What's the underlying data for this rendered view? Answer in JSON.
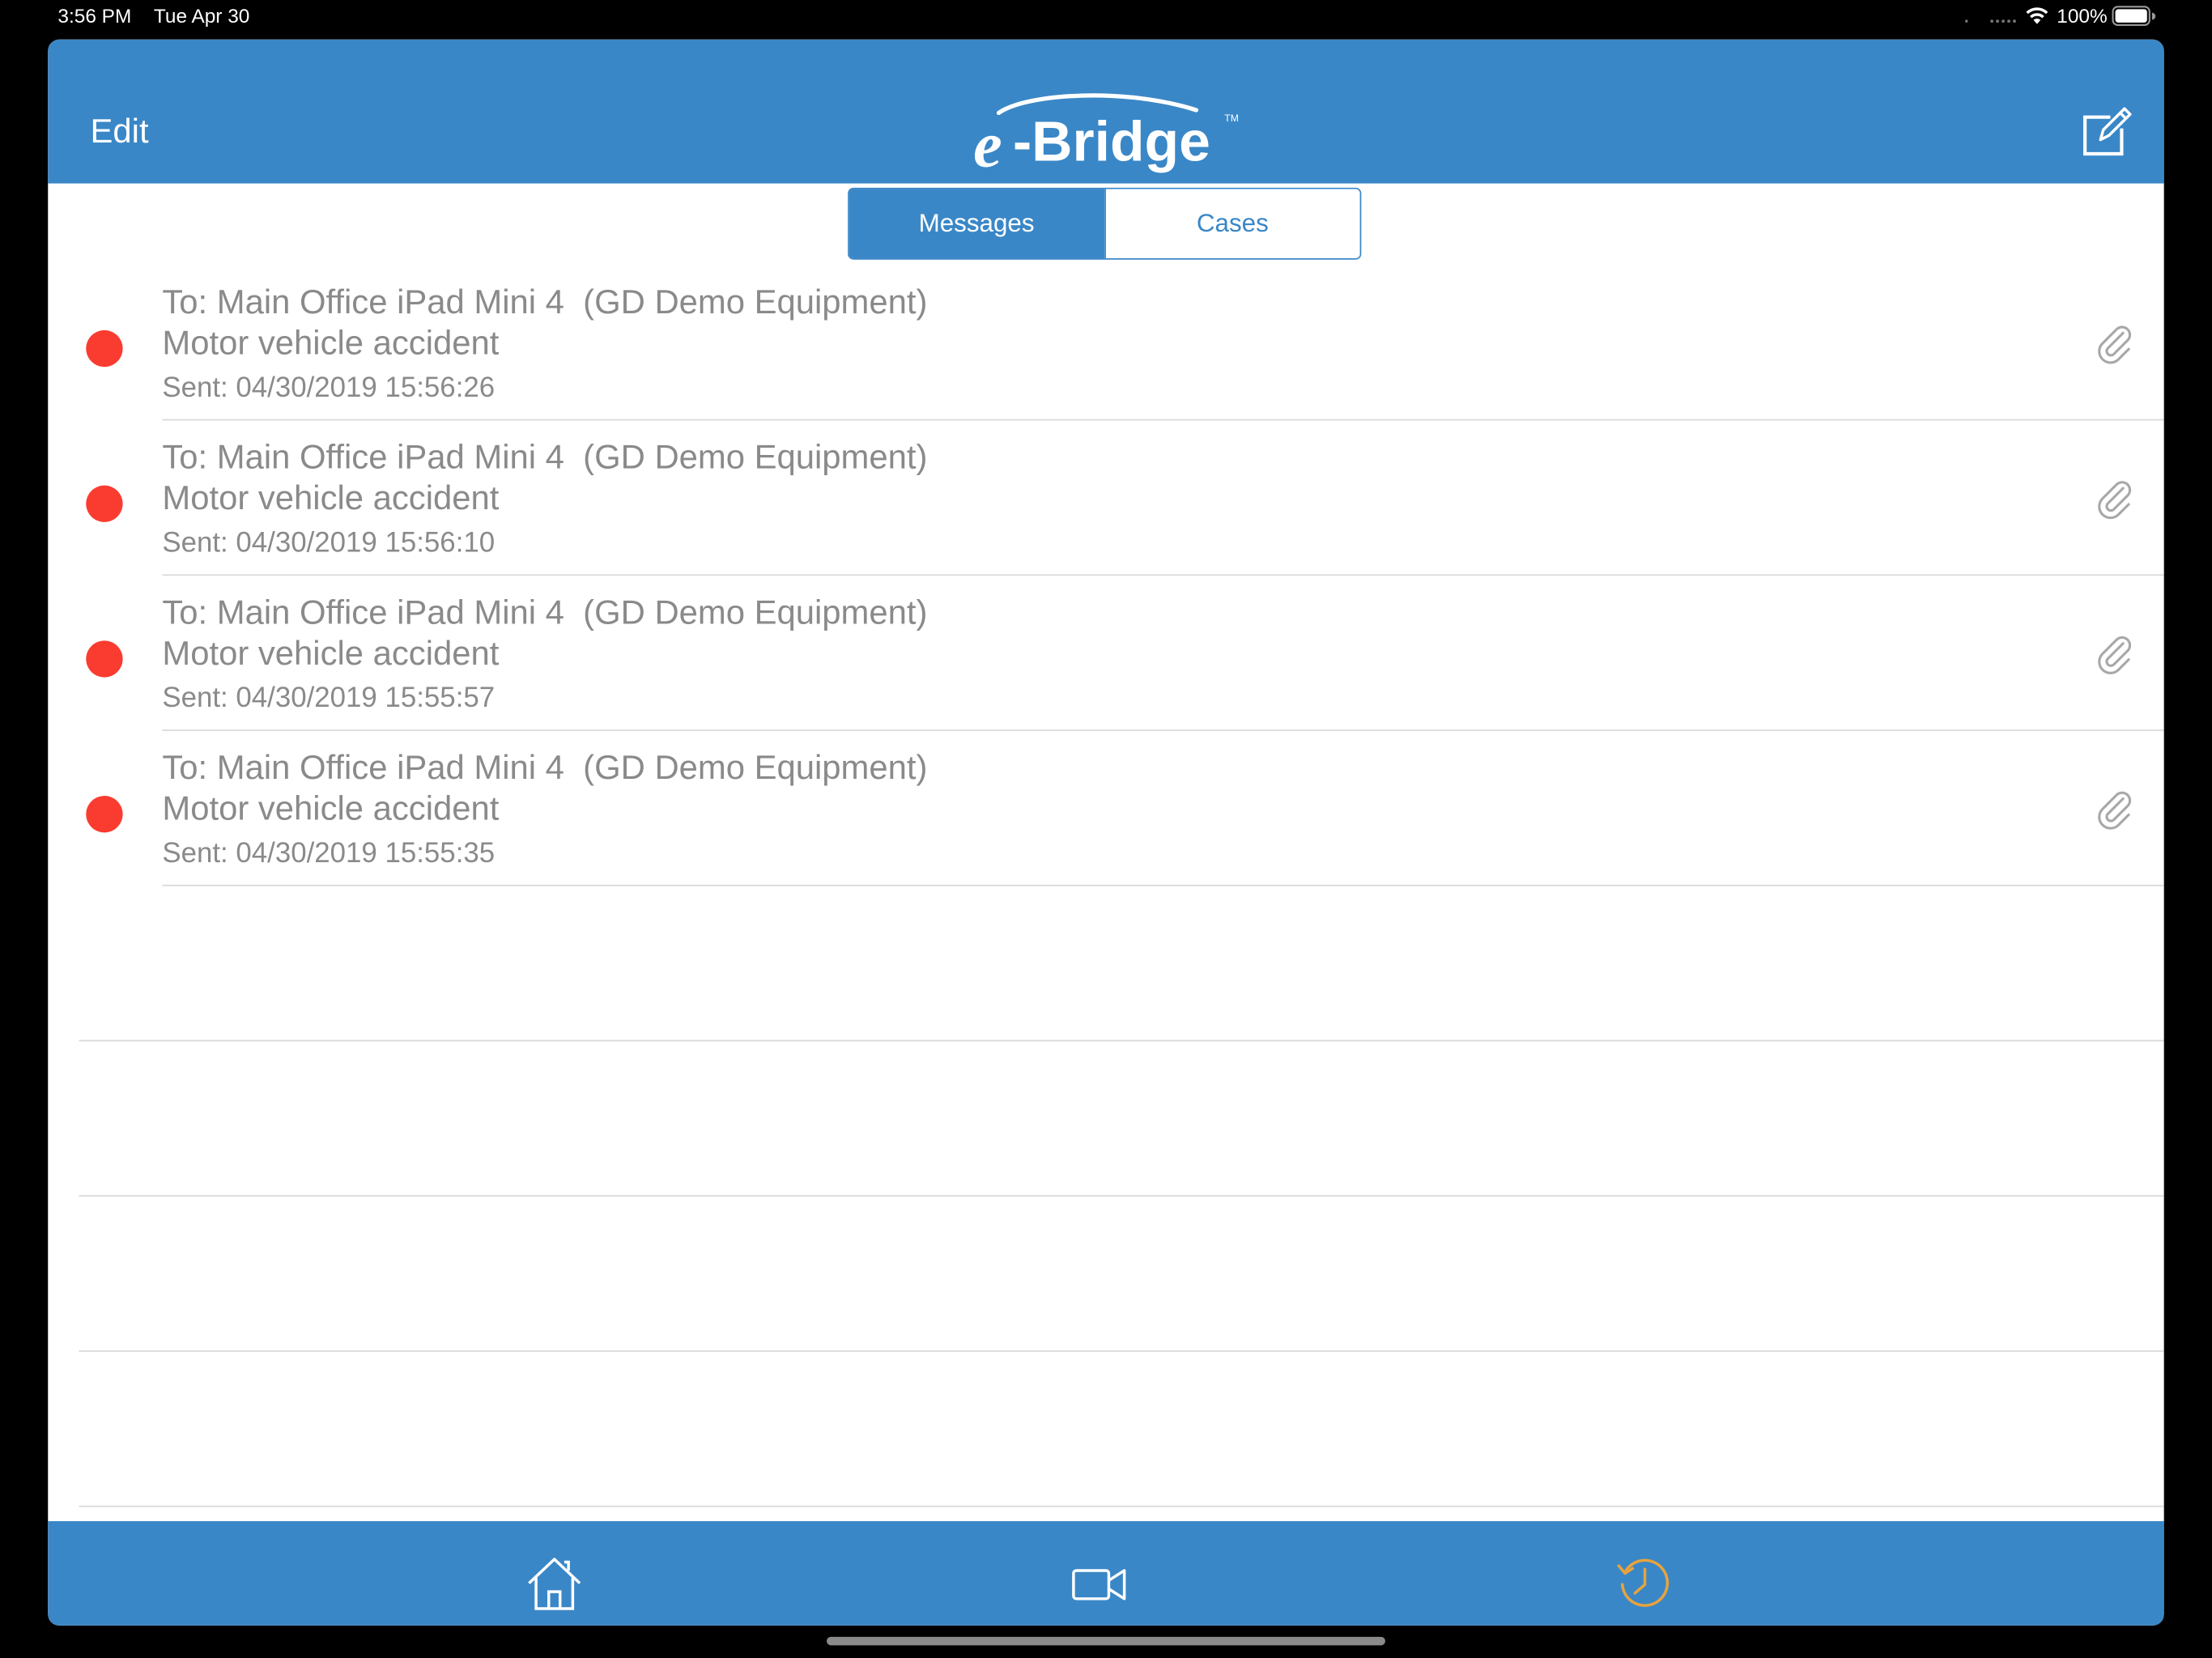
{
  "status_bar": {
    "time": "3:56 PM",
    "date": "Tue Apr 30",
    "battery": "100%",
    "icons": [
      "signal-dots-icon",
      "wifi-icon",
      "battery-icon"
    ]
  },
  "header": {
    "edit_label": "Edit",
    "logo_text": "e-Bridge",
    "compose_icon": "compose-icon"
  },
  "segments": {
    "messages_label": "Messages",
    "cases_label": "Cases",
    "selected": "Messages"
  },
  "messages": [
    {
      "to": "To: Main Office iPad Mini 4  (GD Demo Equipment)",
      "subject": "Motor vehicle accident",
      "sent": "Sent: 04/30/2019 15:56:26",
      "unread": true,
      "attachment": true
    },
    {
      "to": "To: Main Office iPad Mini 4  (GD Demo Equipment)",
      "subject": "Motor vehicle accident",
      "sent": "Sent: 04/30/2019 15:56:10",
      "unread": true,
      "attachment": true
    },
    {
      "to": "To: Main Office iPad Mini 4  (GD Demo Equipment)",
      "subject": "Motor vehicle accident",
      "sent": "Sent: 04/30/2019 15:55:57",
      "unread": true,
      "attachment": true
    },
    {
      "to": "To: Main Office iPad Mini 4  (GD Demo Equipment)",
      "subject": "Motor vehicle accident",
      "sent": "Sent: 04/30/2019 15:55:35",
      "unread": true,
      "attachment": true
    }
  ],
  "tab_bar": {
    "items": [
      {
        "icon": "home-icon",
        "selected": false
      },
      {
        "icon": "video-camera-icon",
        "selected": false
      },
      {
        "icon": "history-icon",
        "selected": true
      }
    ]
  },
  "colors": {
    "brand_blue": "#3a87c7",
    "unread_dot": "#fa3c30",
    "tab_selected": "#e8a33c",
    "text_gray": "#8a8a8a"
  }
}
